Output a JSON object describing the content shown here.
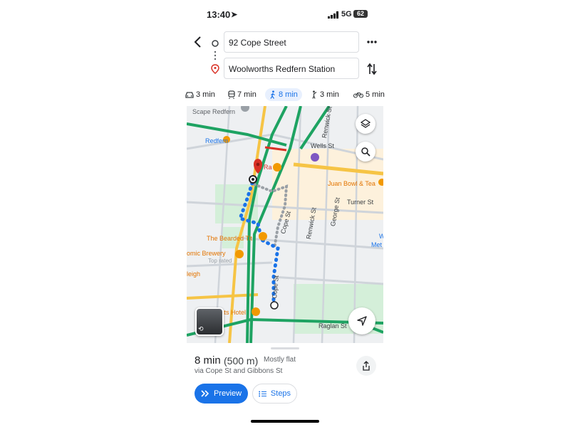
{
  "status_bar": {
    "time": "13:40",
    "network": "5G",
    "battery": "62"
  },
  "route": {
    "origin_value": "92 Cope Street",
    "destination_value": "Woolworths Redfern Station"
  },
  "modes": [
    {
      "icon": "car-icon",
      "label": "3 min"
    },
    {
      "icon": "train-icon",
      "label": "7 min"
    },
    {
      "icon": "walk-icon",
      "label": "8 min",
      "selected": true
    },
    {
      "icon": "rideshare-icon",
      "label": "3 min"
    },
    {
      "icon": "bike-icon",
      "label": "5 min"
    }
  ],
  "map": {
    "labels": {
      "scape_redfern": "Scape Redfern",
      "redfern": "Redfern",
      "wells_st": "Wells St",
      "renwick_st": "Renwick St",
      "juan_bowl": "Juan Bowl & Tea",
      "turner_st": "Turner St",
      "george_st": "George St",
      "bearded_tit": "The Bearded Tit",
      "cope_st": "Cope St",
      "renwick_st2": "Renwick St",
      "omic_brewery": "omic Brewery",
      "top_rated": "Top rated",
      "leigh": "leigh",
      "tts_hotel": "tts Hotel",
      "raglan_st": "Raglan St",
      "cope_st2": "Cope St",
      "w": "W",
      "met": "Met",
      "ra": "Ra"
    }
  },
  "summary": {
    "duration": "8 min",
    "distance": "(500 m)",
    "terrain": "Mostly flat",
    "via": "via Cope St and Gibbons St",
    "preview_label": "Preview",
    "steps_label": "Steps"
  }
}
